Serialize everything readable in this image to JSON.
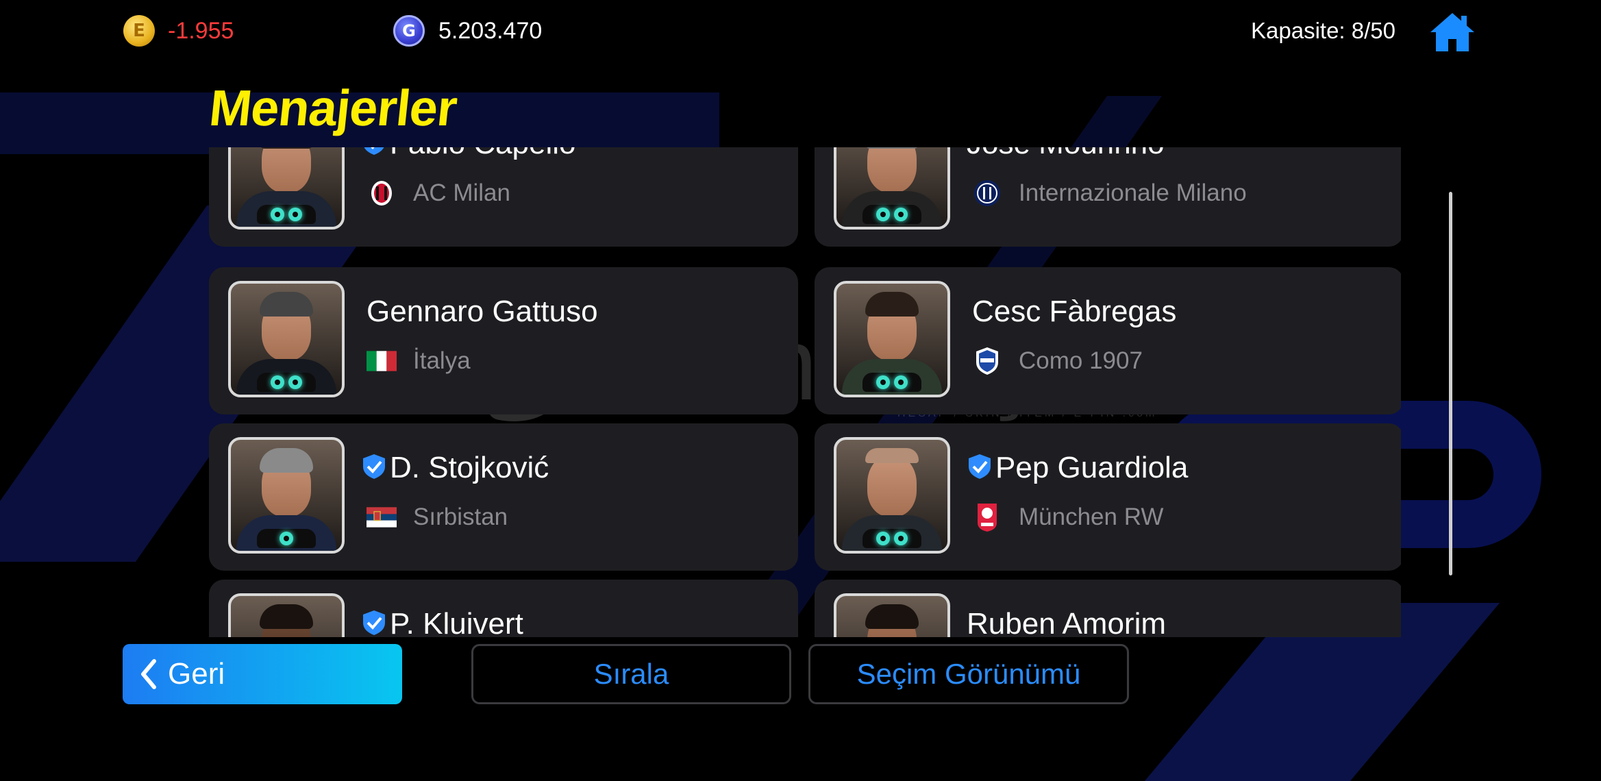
{
  "currency": {
    "coins_value": "-1.955",
    "gp_value": "5.203.470",
    "coins_icon_letter": "E",
    "gp_icon_letter": "G"
  },
  "capacity": "Kapasite: 8/50",
  "title": "Menajerler",
  "managers": [
    {
      "name": "Fabio Capello",
      "verified": true,
      "club": "AC Milan",
      "emblem": "ac-milan-crest"
    },
    {
      "name": "José Mourinho",
      "verified": false,
      "club": "Internazionale Milano",
      "emblem": "inter-crest"
    },
    {
      "name": "Gennaro Gattuso",
      "verified": false,
      "club": "İtalya",
      "emblem": "italy-flag"
    },
    {
      "name": "Cesc Fàbregas",
      "verified": false,
      "club": "Como 1907",
      "emblem": "como-crest"
    },
    {
      "name": "D. Stojković",
      "verified": true,
      "club": "Sırbistan",
      "emblem": "serbia-flag"
    },
    {
      "name": "Pep Guardiola",
      "verified": true,
      "club": "München RW",
      "emblem": "munchen-rw-crest"
    },
    {
      "name": "P. Kluivert",
      "verified": true,
      "club": "",
      "emblem": ""
    },
    {
      "name": "Ruben Amorim",
      "verified": false,
      "club": "",
      "emblem": ""
    }
  ],
  "buttons": {
    "back": "Geri",
    "sort": "Sırala",
    "selection_view": "Seçim Görünümü"
  },
  "watermark": {
    "text": "itemsatış",
    "sub": "HESAP / SKIN / ITEM / E-PIN .com"
  },
  "colors": {
    "title": "#ffef00",
    "coins_negative": "#ff3b3b",
    "accent_blue": "#2b8cff",
    "card_bg": "#1e1e22"
  }
}
